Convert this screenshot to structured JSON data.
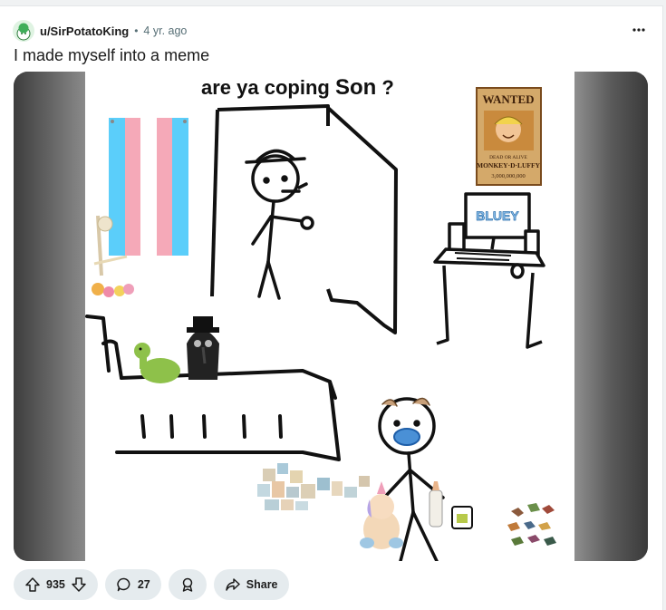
{
  "post": {
    "author": "u/SirPotatoKing",
    "separator": "•",
    "time": "4 yr. ago",
    "title": "I made myself into a meme"
  },
  "meme": {
    "caption_main": "are ya coping",
    "caption_son": "Son",
    "caption_q": "?",
    "poster_header": "WANTED",
    "poster_sub": "DEAD OR ALIVE",
    "poster_name": "MONKEY·D·LUFFY",
    "poster_bounty": "3,000,000,000",
    "monitor_logo": "BLUEY"
  },
  "actions": {
    "upvotes": "935",
    "comments": "27",
    "share": "Share"
  },
  "icons": {
    "avatar": "snoo-avatar-icon",
    "more": "more-horizontal-icon",
    "upvote": "upvote-arrow-icon",
    "downvote": "downvote-arrow-icon",
    "comment": "comment-bubble-icon",
    "award": "award-icon",
    "share": "share-arrow-icon"
  },
  "colors": {
    "trans_blue": "#5bcefa",
    "trans_pink": "#f5a9b8",
    "action_bg": "#e5ebee",
    "text": "#1c1c1c",
    "meta": "#576f76"
  }
}
